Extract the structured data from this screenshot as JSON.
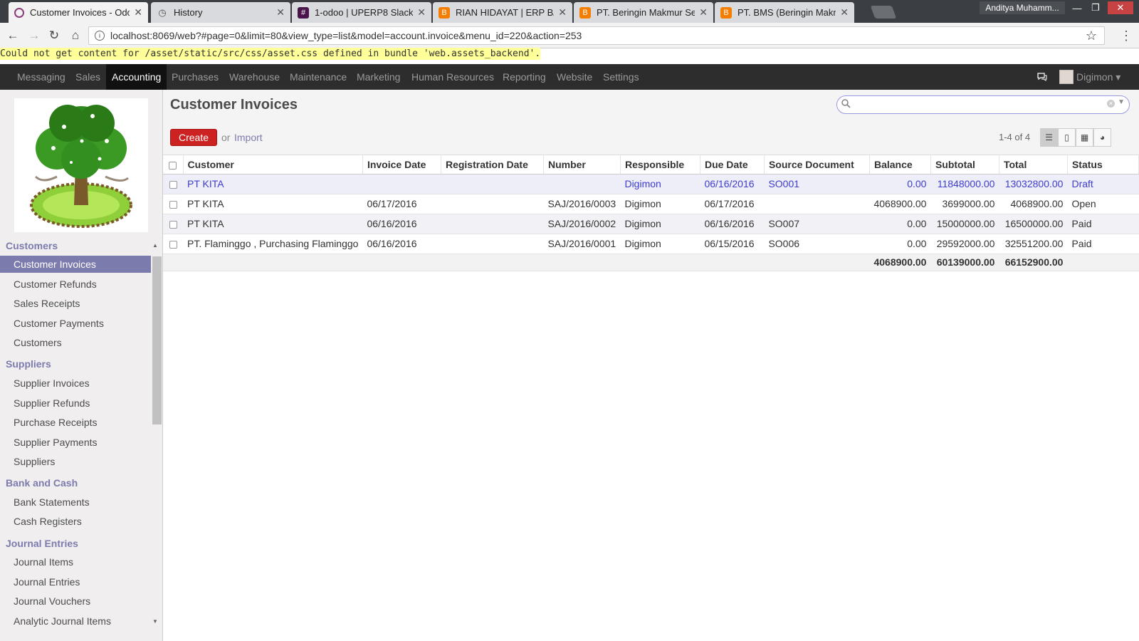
{
  "browser": {
    "tabs": [
      {
        "label": "Customer Invoices - Odoo",
        "favicon": "odoo-icon",
        "active": true
      },
      {
        "label": "History",
        "favicon": "history-icon",
        "active": false
      },
      {
        "label": "1-odoo | UPERP8 Slack",
        "favicon": "slack-icon",
        "active": false
      },
      {
        "label": "RIAN HIDAYAT | ERP BATO",
        "favicon": "blogger-icon",
        "active": false
      },
      {
        "label": "PT. Beringin Makmur Sedaya",
        "favicon": "blogger-icon",
        "active": false
      },
      {
        "label": "PT. BMS (Beringin Makmur",
        "favicon": "blogger-icon",
        "active": false
      }
    ],
    "profile_name": "Anditya Muhamm...",
    "url": "localhost:8069/web?#page=0&limit=80&view_type=list&model=account.invoice&menu_id=220&action=253",
    "error_message": "Could not get content for /asset/static/src/css/asset.css defined in bundle 'web.assets_backend'."
  },
  "topmenu": {
    "items": [
      "Messaging",
      "Sales",
      "Accounting",
      "Purchases",
      "Warehouse",
      "Maintenance",
      "Marketing",
      "Human Resources",
      "Reporting",
      "Website",
      "Settings"
    ],
    "active": "Accounting",
    "user": "Digimon"
  },
  "sidebar": {
    "sections": [
      {
        "title": "Customers",
        "items": [
          "Customer Invoices",
          "Customer Refunds",
          "Sales Receipts",
          "Customer Payments",
          "Customers"
        ]
      },
      {
        "title": "Suppliers",
        "items": [
          "Supplier Invoices",
          "Supplier Refunds",
          "Purchase Receipts",
          "Supplier Payments",
          "Suppliers"
        ]
      },
      {
        "title": "Bank and Cash",
        "items": [
          "Bank Statements",
          "Cash Registers"
        ]
      },
      {
        "title": "Journal Entries",
        "items": [
          "Journal Items",
          "Journal Entries",
          "Journal Vouchers",
          "Analytic Journal Items"
        ]
      }
    ],
    "active_item": "Customer Invoices"
  },
  "main": {
    "title": "Customer Invoices",
    "create_label": "Create",
    "or_label": "or",
    "import_label": "Import",
    "pager": "1-4 of 4",
    "search_placeholder": "",
    "columns": [
      "Customer",
      "Invoice Date",
      "Registration Date",
      "Number",
      "Responsible",
      "Due Date",
      "Source Document",
      "Balance",
      "Subtotal",
      "Total",
      "Status"
    ],
    "rows": [
      {
        "customer": "PT KITA",
        "invoice_date": "",
        "registration_date": "",
        "number": "",
        "responsible": "Digimon",
        "due_date": "06/16/2016",
        "source": "SO001",
        "balance": "0.00",
        "subtotal": "11848000.00",
        "total": "13032800.00",
        "status": "Draft"
      },
      {
        "customer": "PT KITA",
        "invoice_date": "06/17/2016",
        "registration_date": "",
        "number": "SAJ/2016/0003",
        "responsible": "Digimon",
        "due_date": "06/17/2016",
        "source": "",
        "balance": "4068900.00",
        "subtotal": "3699000.00",
        "total": "4068900.00",
        "status": "Open"
      },
      {
        "customer": "PT KITA",
        "invoice_date": "06/16/2016",
        "registration_date": "",
        "number": "SAJ/2016/0002",
        "responsible": "Digimon",
        "due_date": "06/16/2016",
        "source": "SO007",
        "balance": "0.00",
        "subtotal": "15000000.00",
        "total": "16500000.00",
        "status": "Paid"
      },
      {
        "customer": "PT. Flaminggo , Purchasing Flaminggo",
        "invoice_date": "06/16/2016",
        "registration_date": "",
        "number": "SAJ/2016/0001",
        "responsible": "Digimon",
        "due_date": "06/15/2016",
        "source": "SO006",
        "balance": "0.00",
        "subtotal": "29592000.00",
        "total": "32551200.00",
        "status": "Paid"
      }
    ],
    "totals": {
      "balance": "4068900.00",
      "subtotal": "60139000.00",
      "total": "66152900.00"
    }
  },
  "colors": {
    "accent": "#7c7bad",
    "create_button": "#cc2222",
    "topbar": "#2d2d2d",
    "draft_text": "#3c3cd0"
  }
}
